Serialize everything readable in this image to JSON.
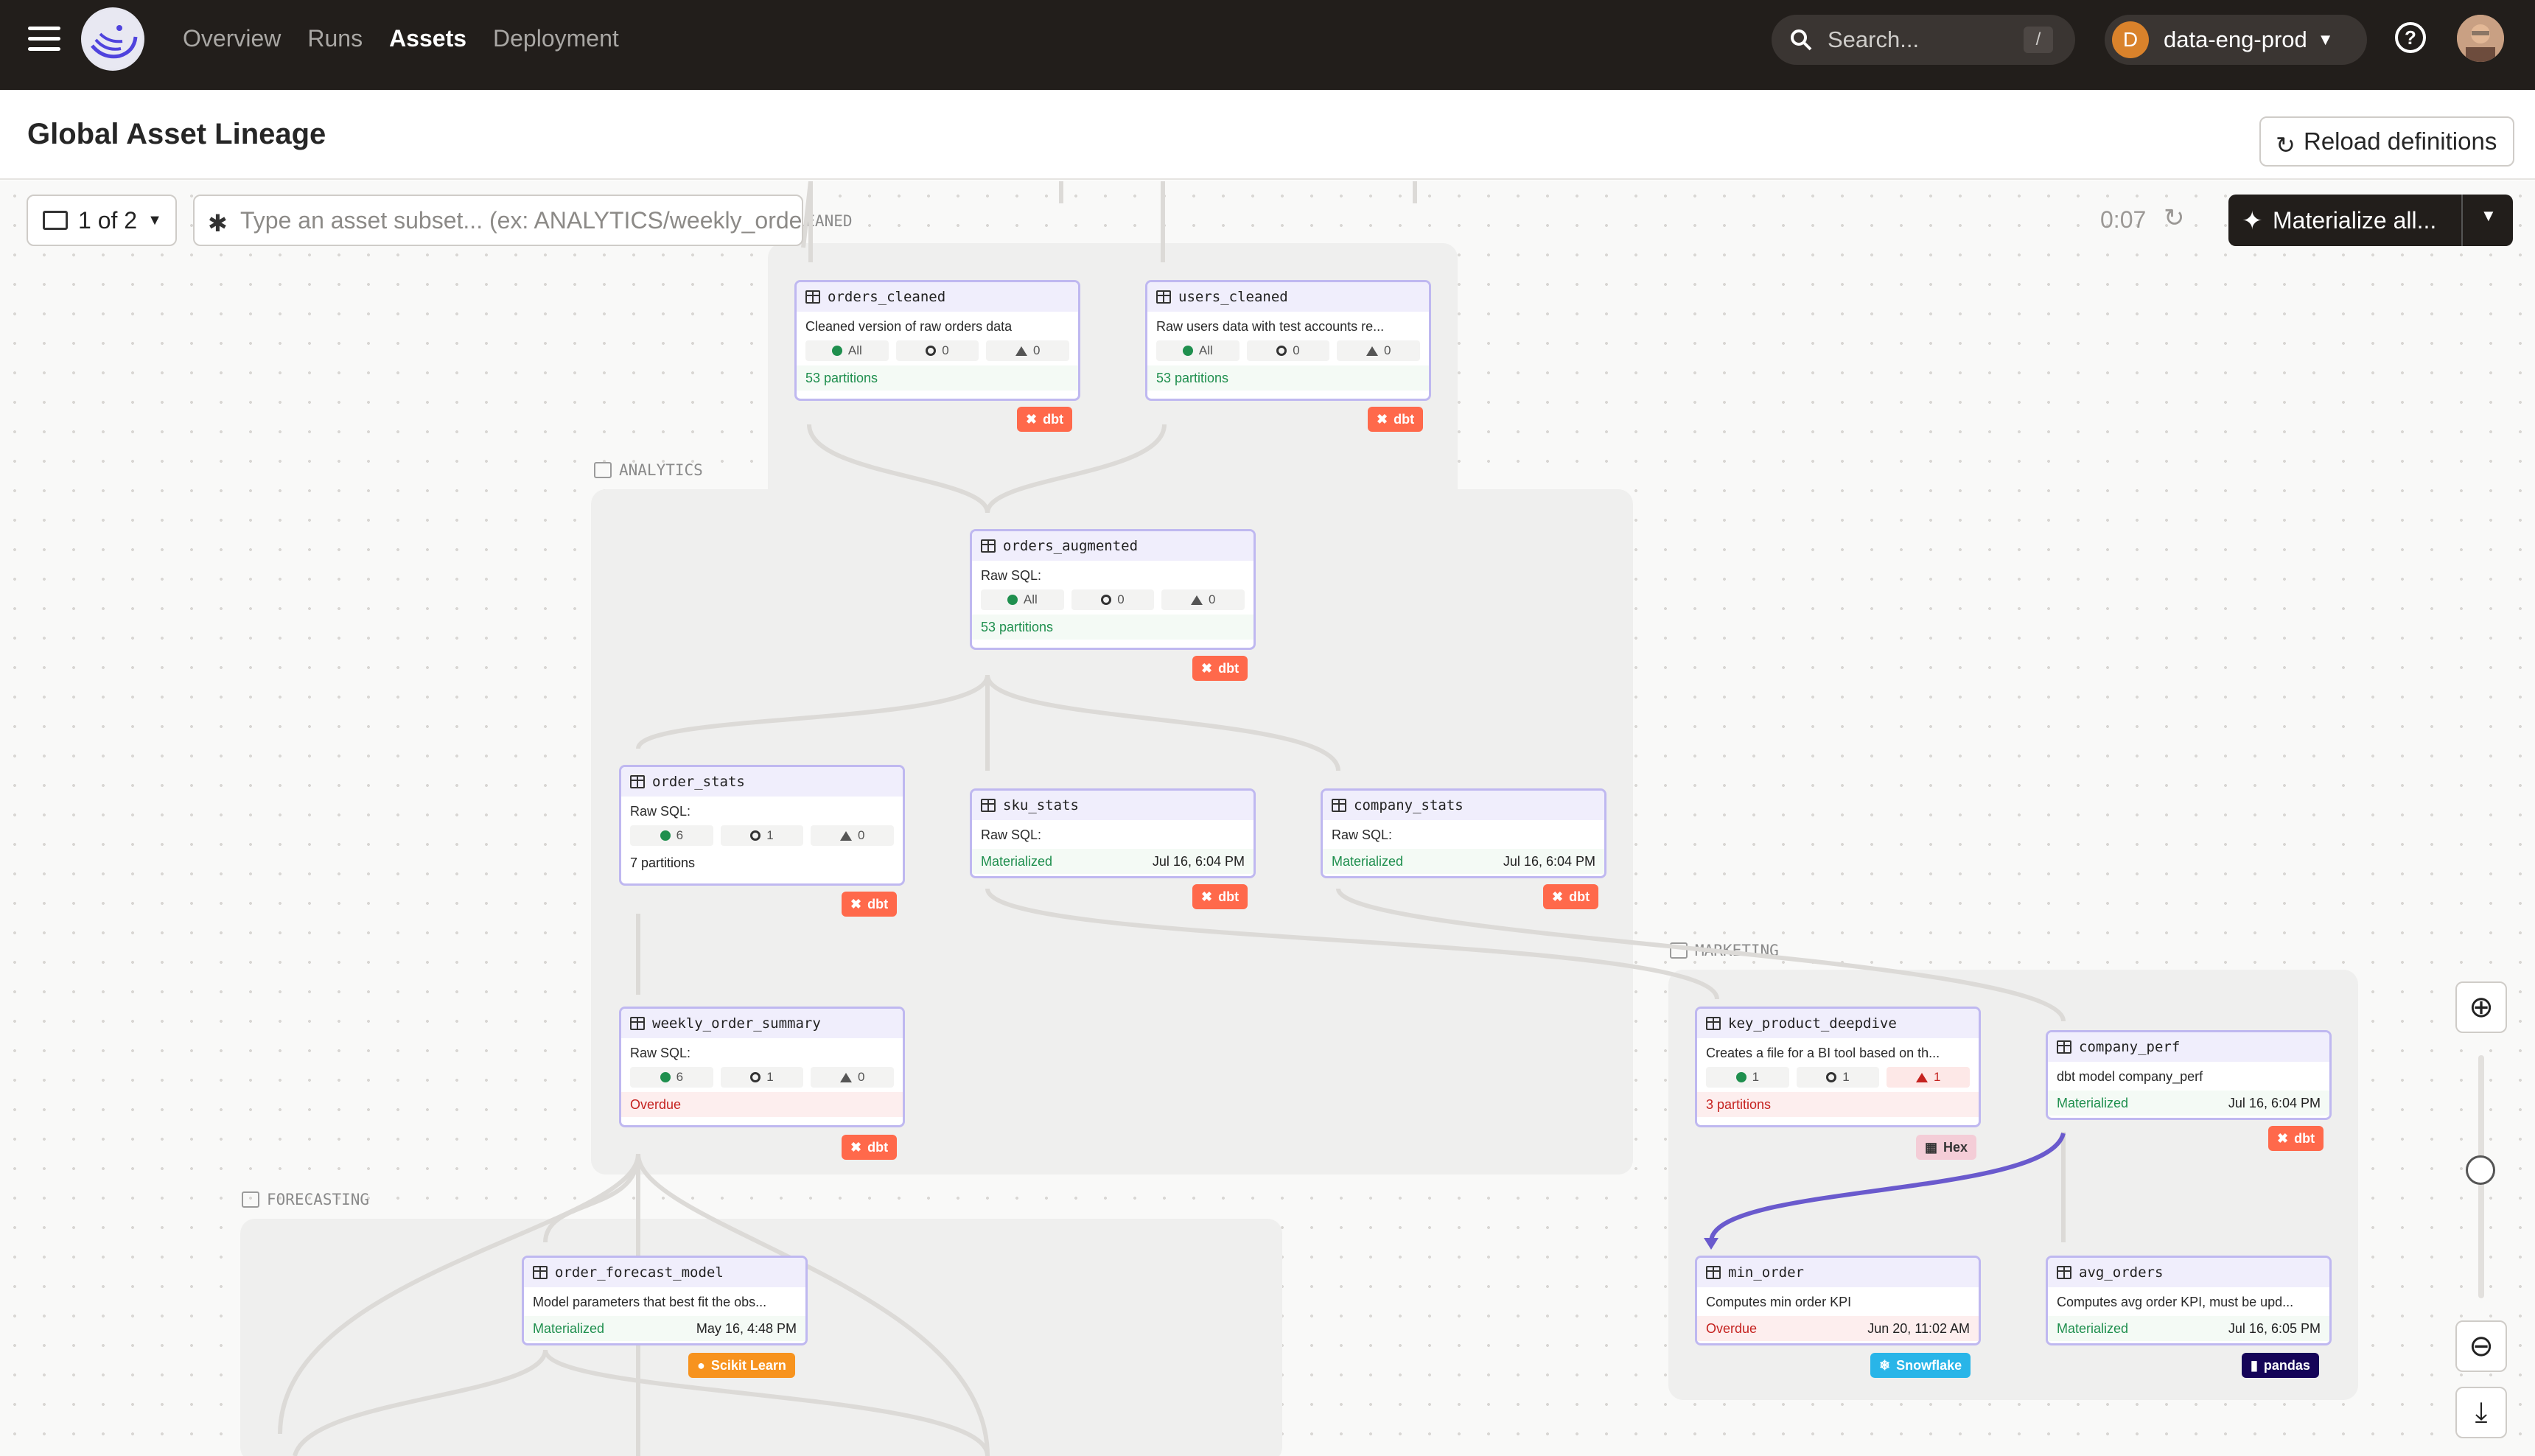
{
  "nav": {
    "items": [
      "Overview",
      "Runs",
      "Assets",
      "Deployment"
    ],
    "active": "Assets"
  },
  "search": {
    "placeholder": "Search...",
    "shortcut": "/"
  },
  "workspace": {
    "initial": "D",
    "name": "data-eng-prod"
  },
  "page": {
    "title": "Global Asset Lineage",
    "reload_label": "Reload definitions"
  },
  "toolbar": {
    "page_selector": "1 of 2",
    "subset_placeholder": "Type an asset subset... (ex: ANALYTICS/weekly_orders)",
    "timer": "0:07",
    "materialize_label": "Materialize all..."
  },
  "groups": {
    "cleaned": "CLEANED",
    "analytics": "ANALYTICS",
    "marketing": "MARKETING",
    "forecasting": "FORECASTING"
  },
  "nodes": {
    "orders_cleaned": {
      "name": "orders_cleaned",
      "desc": "Cleaned version of raw orders data",
      "s1": "All",
      "s2": "0",
      "s3": "0",
      "foot": "53 partitions",
      "kind": "dbt"
    },
    "users_cleaned": {
      "name": "users_cleaned",
      "desc": "Raw users data with test accounts re...",
      "s1": "All",
      "s2": "0",
      "s3": "0",
      "foot": "53 partitions",
      "kind": "dbt"
    },
    "orders_augmented": {
      "name": "orders_augmented",
      "desc": "Raw SQL:",
      "s1": "All",
      "s2": "0",
      "s3": "0",
      "foot": "53 partitions",
      "kind": "dbt"
    },
    "order_stats": {
      "name": "order_stats",
      "desc": "Raw SQL:",
      "s1": "6",
      "s2": "1",
      "s3": "0",
      "foot": "7 partitions",
      "kind": "dbt"
    },
    "sku_stats": {
      "name": "sku_stats",
      "desc": "Raw SQL:",
      "status": "Materialized",
      "date": "Jul 16, 6:04 PM",
      "kind": "dbt"
    },
    "company_stats": {
      "name": "company_stats",
      "desc": "Raw SQL:",
      "status": "Materialized",
      "date": "Jul 16, 6:04 PM",
      "kind": "dbt"
    },
    "weekly_order_summary": {
      "name": "weekly_order_summary",
      "desc": "Raw SQL:",
      "s1": "6",
      "s2": "1",
      "s3": "0",
      "status": "Overdue",
      "kind": "dbt"
    },
    "key_product_deepdive": {
      "name": "key_product_deepdive",
      "desc": "Creates a file for a BI tool based on th...",
      "s1": "1",
      "s2": "1",
      "s3": "1",
      "foot": "3 partitions",
      "kind": "Hex"
    },
    "company_perf": {
      "name": "company_perf",
      "desc": "dbt model company_perf",
      "status": "Materialized",
      "date": "Jul 16, 6:04 PM",
      "kind": "dbt"
    },
    "order_forecast_model": {
      "name": "order_forecast_model",
      "desc": "Model parameters that best fit the obs...",
      "status": "Materialized",
      "date": "May 16, 4:48 PM",
      "kind": "Scikit Learn"
    },
    "min_order": {
      "name": "min_order",
      "desc": "Computes min order KPI",
      "status": "Overdue",
      "date": "Jun 20, 11:02 AM",
      "kind": "Snowflake"
    },
    "avg_orders": {
      "name": "avg_orders",
      "desc": "Computes avg order KPI, must be upd...",
      "status": "Materialized",
      "date": "Jul 16, 6:05 PM",
      "kind": "pandas"
    }
  },
  "colors": {
    "topbar": "#221e1b",
    "dbt": "#ff694b",
    "materialized": "#1f8f4e",
    "overdue": "#c5221f",
    "selected_edge": "#6a5acd"
  }
}
